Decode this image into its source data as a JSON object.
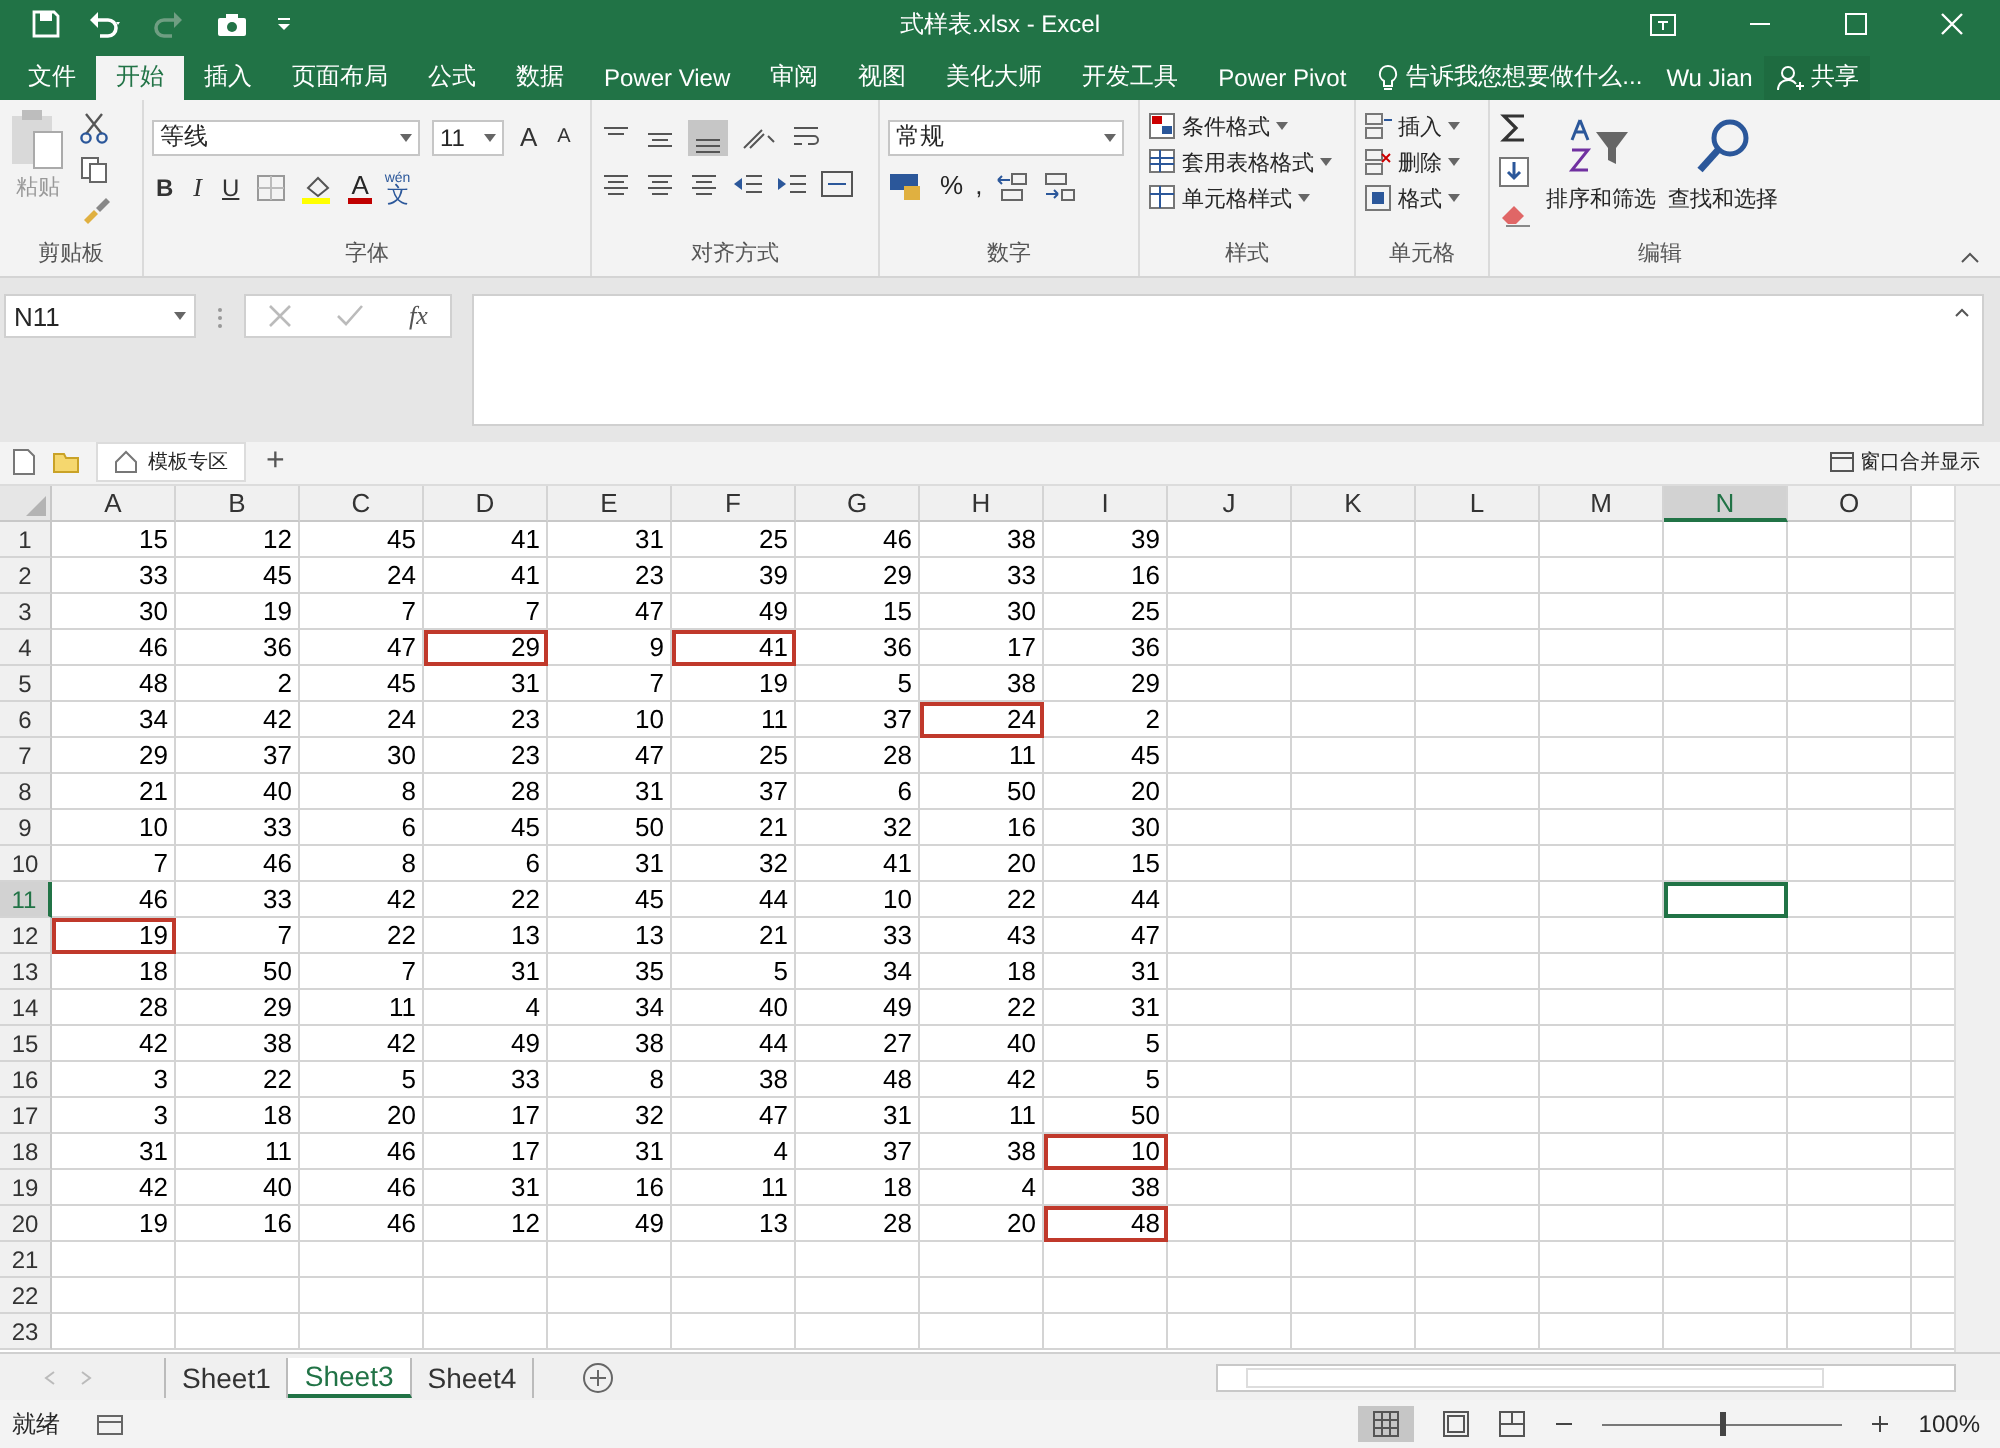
{
  "window": {
    "title": "式样表.xlsx - Excel",
    "redo_disabled": true
  },
  "ribbon_tabs": [
    {
      "label": "文件",
      "selected": false
    },
    {
      "label": "开始",
      "selected": true
    },
    {
      "label": "插入",
      "selected": false
    },
    {
      "label": "页面布局",
      "selected": false
    },
    {
      "label": "公式",
      "selected": false
    },
    {
      "label": "数据",
      "selected": false
    },
    {
      "label": "Power View",
      "selected": false
    },
    {
      "label": "审阅",
      "selected": false
    },
    {
      "label": "视图",
      "selected": false
    },
    {
      "label": "美化大师",
      "selected": false
    },
    {
      "label": "开发工具",
      "selected": false
    },
    {
      "label": "Power Pivot",
      "selected": false
    }
  ],
  "tell_me": "告诉我您想要做什么...",
  "user": "Wu Jian",
  "share": "共享",
  "ribbon": {
    "paste": "粘贴",
    "font_name": "等线",
    "font_size": "11",
    "grow_font": "A",
    "shrink_font": "A",
    "bold": "B",
    "italic": "I",
    "underline": "U",
    "font_color": "A",
    "phonetic_top": "wén",
    "phonetic": "文",
    "number_format": "常规",
    "percent": "%",
    "comma": ",",
    "conditional": "条件格式",
    "table_format": "套用表格格式",
    "cell_styles": "单元格样式",
    "insert": "插入",
    "delete": "删除",
    "format": "格式",
    "sort_filter": "排序和筛选",
    "find_select": "查找和选择",
    "groups": [
      "剪贴板",
      "字体",
      "对齐方式",
      "数字",
      "样式",
      "单元格",
      "编辑"
    ]
  },
  "formula_bar": {
    "name_box": "N11",
    "fx": "fx"
  },
  "tab_strip": {
    "template": "模板专区",
    "add": "+",
    "merge": "窗口合并显示"
  },
  "columns": [
    {
      "label": "A",
      "selected": false
    },
    {
      "label": "B",
      "selected": false
    },
    {
      "label": "C",
      "selected": false
    },
    {
      "label": "D",
      "selected": false
    },
    {
      "label": "E",
      "selected": false
    },
    {
      "label": "F",
      "selected": false
    },
    {
      "label": "G",
      "selected": false
    },
    {
      "label": "H",
      "selected": false
    },
    {
      "label": "I",
      "selected": false
    },
    {
      "label": "J",
      "selected": false
    },
    {
      "label": "K",
      "selected": false
    },
    {
      "label": "L",
      "selected": false
    },
    {
      "label": "M",
      "selected": false
    },
    {
      "label": "N",
      "selected": true
    },
    {
      "label": "O",
      "selected": false
    }
  ],
  "rows": [
    {
      "label": "1",
      "selected": false,
      "cells": [
        {
          "value": "15",
          "marked": false
        },
        {
          "value": "12",
          "marked": false
        },
        {
          "value": "45",
          "marked": false
        },
        {
          "value": "41",
          "marked": false
        },
        {
          "value": "31",
          "marked": false
        },
        {
          "value": "25",
          "marked": false
        },
        {
          "value": "46",
          "marked": false
        },
        {
          "value": "38",
          "marked": false
        },
        {
          "value": "39",
          "marked": false
        }
      ]
    },
    {
      "label": "2",
      "selected": false,
      "cells": [
        {
          "value": "33",
          "marked": false
        },
        {
          "value": "45",
          "marked": false
        },
        {
          "value": "24",
          "marked": false
        },
        {
          "value": "41",
          "marked": false
        },
        {
          "value": "23",
          "marked": false
        },
        {
          "value": "39",
          "marked": false
        },
        {
          "value": "29",
          "marked": false
        },
        {
          "value": "33",
          "marked": false
        },
        {
          "value": "16",
          "marked": false
        }
      ]
    },
    {
      "label": "3",
      "selected": false,
      "cells": [
        {
          "value": "30",
          "marked": false
        },
        {
          "value": "19",
          "marked": false
        },
        {
          "value": "7",
          "marked": false
        },
        {
          "value": "7",
          "marked": false
        },
        {
          "value": "47",
          "marked": false
        },
        {
          "value": "49",
          "marked": false
        },
        {
          "value": "15",
          "marked": false
        },
        {
          "value": "30",
          "marked": false
        },
        {
          "value": "25",
          "marked": false
        }
      ]
    },
    {
      "label": "4",
      "selected": false,
      "cells": [
        {
          "value": "46",
          "marked": false
        },
        {
          "value": "36",
          "marked": false
        },
        {
          "value": "47",
          "marked": false
        },
        {
          "value": "29",
          "marked": true
        },
        {
          "value": "9",
          "marked": false
        },
        {
          "value": "41",
          "marked": true
        },
        {
          "value": "36",
          "marked": false
        },
        {
          "value": "17",
          "marked": false
        },
        {
          "value": "36",
          "marked": false
        }
      ]
    },
    {
      "label": "5",
      "selected": false,
      "cells": [
        {
          "value": "48",
          "marked": false
        },
        {
          "value": "2",
          "marked": false
        },
        {
          "value": "45",
          "marked": false
        },
        {
          "value": "31",
          "marked": false
        },
        {
          "value": "7",
          "marked": false
        },
        {
          "value": "19",
          "marked": false
        },
        {
          "value": "5",
          "marked": false
        },
        {
          "value": "38",
          "marked": false
        },
        {
          "value": "29",
          "marked": false
        }
      ]
    },
    {
      "label": "6",
      "selected": false,
      "cells": [
        {
          "value": "34",
          "marked": false
        },
        {
          "value": "42",
          "marked": false
        },
        {
          "value": "24",
          "marked": false
        },
        {
          "value": "23",
          "marked": false
        },
        {
          "value": "10",
          "marked": false
        },
        {
          "value": "11",
          "marked": false
        },
        {
          "value": "37",
          "marked": false
        },
        {
          "value": "24",
          "marked": true
        },
        {
          "value": "2",
          "marked": false
        }
      ]
    },
    {
      "label": "7",
      "selected": false,
      "cells": [
        {
          "value": "29",
          "marked": false
        },
        {
          "value": "37",
          "marked": false
        },
        {
          "value": "30",
          "marked": false
        },
        {
          "value": "23",
          "marked": false
        },
        {
          "value": "47",
          "marked": false
        },
        {
          "value": "25",
          "marked": false
        },
        {
          "value": "28",
          "marked": false
        },
        {
          "value": "11",
          "marked": false
        },
        {
          "value": "45",
          "marked": false
        }
      ]
    },
    {
      "label": "8",
      "selected": false,
      "cells": [
        {
          "value": "21",
          "marked": false
        },
        {
          "value": "40",
          "marked": false
        },
        {
          "value": "8",
          "marked": false
        },
        {
          "value": "28",
          "marked": false
        },
        {
          "value": "31",
          "marked": false
        },
        {
          "value": "37",
          "marked": false
        },
        {
          "value": "6",
          "marked": false
        },
        {
          "value": "50",
          "marked": false
        },
        {
          "value": "20",
          "marked": false
        }
      ]
    },
    {
      "label": "9",
      "selected": false,
      "cells": [
        {
          "value": "10",
          "marked": false
        },
        {
          "value": "33",
          "marked": false
        },
        {
          "value": "6",
          "marked": false
        },
        {
          "value": "45",
          "marked": false
        },
        {
          "value": "50",
          "marked": false
        },
        {
          "value": "21",
          "marked": false
        },
        {
          "value": "32",
          "marked": false
        },
        {
          "value": "16",
          "marked": false
        },
        {
          "value": "30",
          "marked": false
        }
      ]
    },
    {
      "label": "10",
      "selected": false,
      "cells": [
        {
          "value": "7",
          "marked": false
        },
        {
          "value": "46",
          "marked": false
        },
        {
          "value": "8",
          "marked": false
        },
        {
          "value": "6",
          "marked": false
        },
        {
          "value": "31",
          "marked": false
        },
        {
          "value": "32",
          "marked": false
        },
        {
          "value": "41",
          "marked": false
        },
        {
          "value": "20",
          "marked": false
        },
        {
          "value": "15",
          "marked": false
        }
      ]
    },
    {
      "label": "11",
      "selected": true,
      "cells": [
        {
          "value": "46",
          "marked": false
        },
        {
          "value": "33",
          "marked": false
        },
        {
          "value": "42",
          "marked": false
        },
        {
          "value": "22",
          "marked": false
        },
        {
          "value": "45",
          "marked": false
        },
        {
          "value": "44",
          "marked": false
        },
        {
          "value": "10",
          "marked": false
        },
        {
          "value": "22",
          "marked": false
        },
        {
          "value": "44",
          "marked": false
        }
      ]
    },
    {
      "label": "12",
      "selected": false,
      "cells": [
        {
          "value": "19",
          "marked": true
        },
        {
          "value": "7",
          "marked": false
        },
        {
          "value": "22",
          "marked": false
        },
        {
          "value": "13",
          "marked": false
        },
        {
          "value": "13",
          "marked": false
        },
        {
          "value": "21",
          "marked": false
        },
        {
          "value": "33",
          "marked": false
        },
        {
          "value": "43",
          "marked": false
        },
        {
          "value": "47",
          "marked": false
        }
      ]
    },
    {
      "label": "13",
      "selected": false,
      "cells": [
        {
          "value": "18",
          "marked": false
        },
        {
          "value": "50",
          "marked": false
        },
        {
          "value": "7",
          "marked": false
        },
        {
          "value": "31",
          "marked": false
        },
        {
          "value": "35",
          "marked": false
        },
        {
          "value": "5",
          "marked": false
        },
        {
          "value": "34",
          "marked": false
        },
        {
          "value": "18",
          "marked": false
        },
        {
          "value": "31",
          "marked": false
        }
      ]
    },
    {
      "label": "14",
      "selected": false,
      "cells": [
        {
          "value": "28",
          "marked": false
        },
        {
          "value": "29",
          "marked": false
        },
        {
          "value": "11",
          "marked": false
        },
        {
          "value": "4",
          "marked": false
        },
        {
          "value": "34",
          "marked": false
        },
        {
          "value": "40",
          "marked": false
        },
        {
          "value": "49",
          "marked": false
        },
        {
          "value": "22",
          "marked": false
        },
        {
          "value": "31",
          "marked": false
        }
      ]
    },
    {
      "label": "15",
      "selected": false,
      "cells": [
        {
          "value": "42",
          "marked": false
        },
        {
          "value": "38",
          "marked": false
        },
        {
          "value": "42",
          "marked": false
        },
        {
          "value": "49",
          "marked": false
        },
        {
          "value": "38",
          "marked": false
        },
        {
          "value": "44",
          "marked": false
        },
        {
          "value": "27",
          "marked": false
        },
        {
          "value": "40",
          "marked": false
        },
        {
          "value": "5",
          "marked": false
        }
      ]
    },
    {
      "label": "16",
      "selected": false,
      "cells": [
        {
          "value": "3",
          "marked": false
        },
        {
          "value": "22",
          "marked": false
        },
        {
          "value": "5",
          "marked": false
        },
        {
          "value": "33",
          "marked": false
        },
        {
          "value": "8",
          "marked": false
        },
        {
          "value": "38",
          "marked": false
        },
        {
          "value": "48",
          "marked": false
        },
        {
          "value": "42",
          "marked": false
        },
        {
          "value": "5",
          "marked": false
        }
      ]
    },
    {
      "label": "17",
      "selected": false,
      "cells": [
        {
          "value": "3",
          "marked": false
        },
        {
          "value": "18",
          "marked": false
        },
        {
          "value": "20",
          "marked": false
        },
        {
          "value": "17",
          "marked": false
        },
        {
          "value": "32",
          "marked": false
        },
        {
          "value": "47",
          "marked": false
        },
        {
          "value": "31",
          "marked": false
        },
        {
          "value": "11",
          "marked": false
        },
        {
          "value": "50",
          "marked": false
        }
      ]
    },
    {
      "label": "18",
      "selected": false,
      "cells": [
        {
          "value": "31",
          "marked": false
        },
        {
          "value": "11",
          "marked": false
        },
        {
          "value": "46",
          "marked": false
        },
        {
          "value": "17",
          "marked": false
        },
        {
          "value": "31",
          "marked": false
        },
        {
          "value": "4",
          "marked": false
        },
        {
          "value": "37",
          "marked": false
        },
        {
          "value": "38",
          "marked": false
        },
        {
          "value": "10",
          "marked": true
        }
      ]
    },
    {
      "label": "19",
      "selected": false,
      "cells": [
        {
          "value": "42",
          "marked": false
        },
        {
          "value": "40",
          "marked": false
        },
        {
          "value": "46",
          "marked": false
        },
        {
          "value": "31",
          "marked": false
        },
        {
          "value": "16",
          "marked": false
        },
        {
          "value": "11",
          "marked": false
        },
        {
          "value": "18",
          "marked": false
        },
        {
          "value": "4",
          "marked": false
        },
        {
          "value": "38",
          "marked": false
        }
      ]
    },
    {
      "label": "20",
      "selected": false,
      "cells": [
        {
          "value": "19",
          "marked": false
        },
        {
          "value": "16",
          "marked": false
        },
        {
          "value": "46",
          "marked": false
        },
        {
          "value": "12",
          "marked": false
        },
        {
          "value": "49",
          "marked": false
        },
        {
          "value": "13",
          "marked": false
        },
        {
          "value": "28",
          "marked": false
        },
        {
          "value": "20",
          "marked": false
        },
        {
          "value": "48",
          "marked": true
        }
      ]
    },
    {
      "label": "21",
      "selected": false,
      "cells": []
    },
    {
      "label": "22",
      "selected": false,
      "cells": []
    },
    {
      "label": "23",
      "selected": false,
      "cells": []
    }
  ],
  "sheets": [
    {
      "label": "Sheet1",
      "selected": false
    },
    {
      "label": "Sheet3",
      "selected": true
    },
    {
      "label": "Sheet4",
      "selected": false
    }
  ],
  "status_bar": {
    "status": "就绪",
    "zoom": "100%",
    "zoom_slider": {
      "level": 0.5
    }
  }
}
